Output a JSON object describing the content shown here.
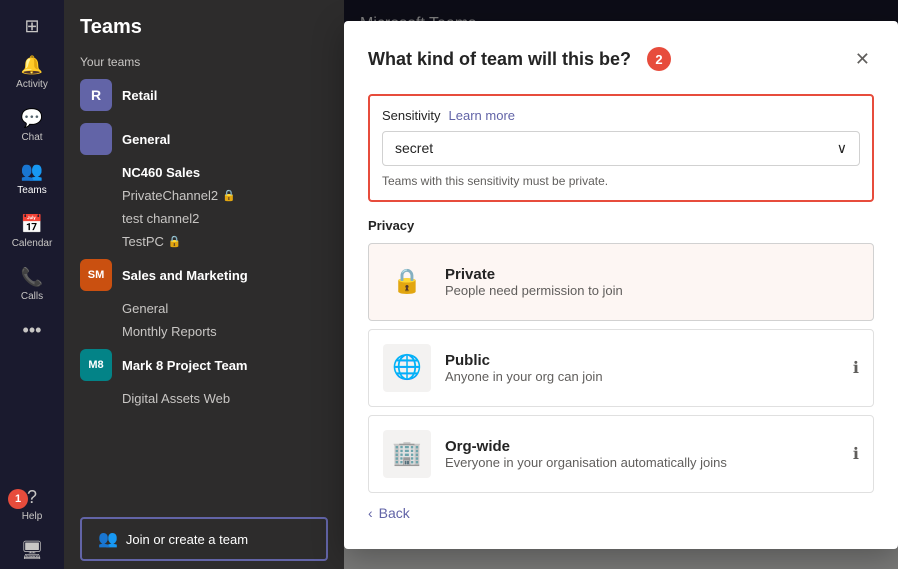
{
  "app": {
    "title": "Microsoft Teams"
  },
  "rail": {
    "items": [
      {
        "id": "activity",
        "label": "Activity",
        "icon": "🔔"
      },
      {
        "id": "chat",
        "label": "Chat",
        "icon": "💬"
      },
      {
        "id": "teams",
        "label": "Teams",
        "icon": "👥"
      },
      {
        "id": "calendar",
        "label": "Calendar",
        "icon": "📅"
      },
      {
        "id": "calls",
        "label": "Calls",
        "icon": "📞"
      },
      {
        "id": "more",
        "label": "...",
        "icon": "···"
      }
    ],
    "bottom": [
      {
        "id": "help",
        "label": "Help",
        "icon": "?"
      }
    ]
  },
  "sidebar": {
    "title": "Teams",
    "your_teams_label": "Your teams",
    "teams": [
      {
        "id": "retail",
        "name": "Retail",
        "avatar_text": "R",
        "avatar_class": "retail",
        "channels": []
      },
      {
        "id": "general-team",
        "name": "General",
        "avatar_text": "",
        "channels": [
          {
            "name": "NC460 Sales",
            "bold": false,
            "lock": false
          },
          {
            "name": "PrivateChannel2",
            "bold": false,
            "lock": true
          },
          {
            "name": "test channel2",
            "bold": false,
            "lock": false
          },
          {
            "name": "TestPC",
            "bold": false,
            "lock": true
          }
        ]
      },
      {
        "id": "sales-marketing",
        "name": "Sales and Marketing",
        "avatar_text": "SM",
        "avatar_class": "sales",
        "channels": [
          {
            "name": "General",
            "bold": false,
            "lock": false
          },
          {
            "name": "Monthly Reports",
            "bold": false,
            "lock": false
          }
        ]
      },
      {
        "id": "mark8",
        "name": "Mark 8 Project Team",
        "avatar_text": "M8",
        "avatar_class": "mark8",
        "channels": []
      }
    ],
    "digital_assets": "Digital Assets Web",
    "join_create_label": "Join or create a team"
  },
  "badge1": "1",
  "badge2": "2",
  "modal": {
    "title": "What kind of team will this be?",
    "close_label": "✕",
    "sensitivity": {
      "label": "Sensitivity",
      "learn_more": "Learn more",
      "value": "secret",
      "hint": "Teams with this sensitivity must be private.",
      "dropdown_arrow": "∨"
    },
    "privacy": {
      "label": "Privacy",
      "options": [
        {
          "id": "private",
          "name": "Private",
          "desc": "People need permission to join",
          "icon": "🔒",
          "bg_class": "private-bg",
          "selected": true,
          "has_info": false
        },
        {
          "id": "public",
          "name": "Public",
          "desc": "Anyone in your org can join",
          "icon": "🌐",
          "bg_class": "public-bg",
          "selected": false,
          "has_info": true
        },
        {
          "id": "orgwide",
          "name": "Org-wide",
          "desc": "Everyone in your organisation automatically joins",
          "icon": "🏢",
          "bg_class": "orgwide-bg",
          "selected": false,
          "has_info": true
        }
      ]
    },
    "back_label": "Back",
    "back_arrow": "‹"
  }
}
